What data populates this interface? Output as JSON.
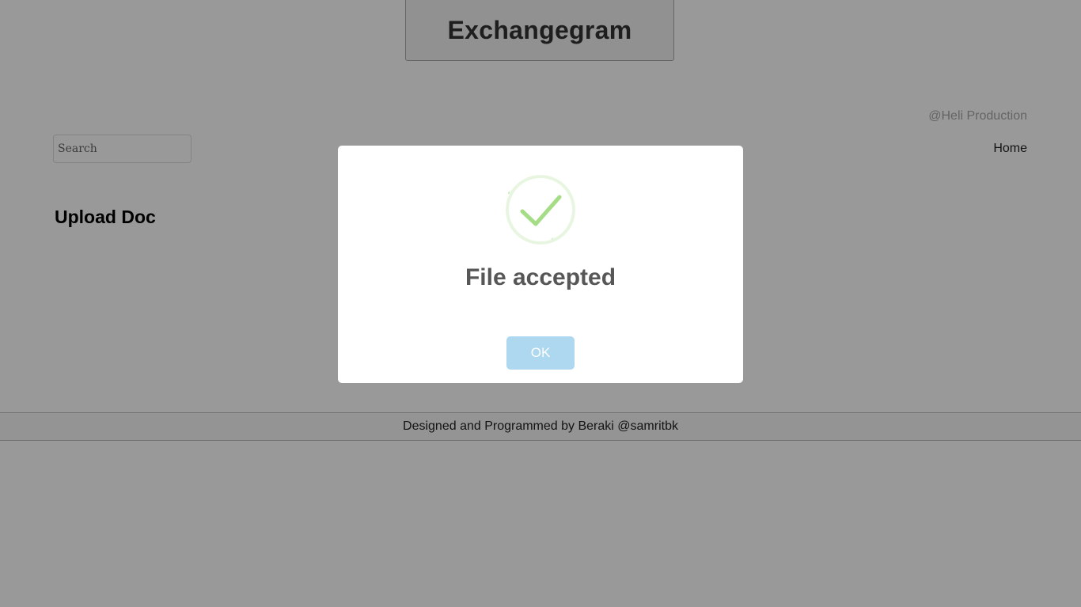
{
  "header": {
    "title": "Exchangegram",
    "credit": "@Heli Production"
  },
  "nav": {
    "search_placeholder": "Search",
    "home_label": "Home"
  },
  "main": {
    "section_title": "Upload Doc"
  },
  "footer": {
    "text": "Designed and Programmed by Beraki @samritbk"
  },
  "modal": {
    "icon": "success-check-icon",
    "title": "File accepted",
    "ok_label": "OK"
  },
  "colors": {
    "overlay": "rgba(0,0,0,0.4)",
    "check_green": "#a5dc86",
    "ok_button": "#add8f0",
    "modal_title": "#575757"
  }
}
